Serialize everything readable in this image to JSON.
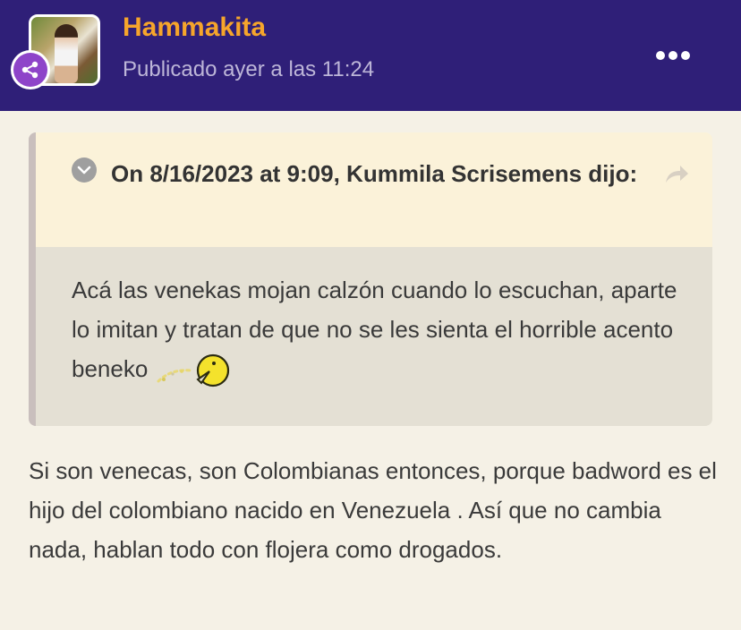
{
  "post": {
    "username": "Hammakita",
    "posted_at": "Publicado ayer a las 11:24",
    "more_icon": "ellipsis-icon",
    "badge_icon": "share-nodes-icon"
  },
  "quote": {
    "title": "On 8/16/2023 at 9:09, Kummila Scrisemens dijo:",
    "body": "Acá las venekas mojan calzón cuando lo escuchan, aparte lo imitan y tratan de que no se les sienta el horrible acento beneko",
    "toggle_icon": "chevron-down-icon",
    "share_icon": "share-arrow-icon"
  },
  "content": {
    "text": "Si son venecas, son Colombianas entonces, porque badword es el hijo del colombiano nacido en Venezuela . Así que  no cambia nada, hablan todo con flojera como drogados."
  },
  "colors": {
    "header_bg": "#2f1f78",
    "username": "#f6a52b",
    "page_bg": "#f5f1e6",
    "quote_head_bg": "#fbf2d9",
    "quote_body_bg": "#e4e0d4",
    "badge": "#8e44c9"
  }
}
